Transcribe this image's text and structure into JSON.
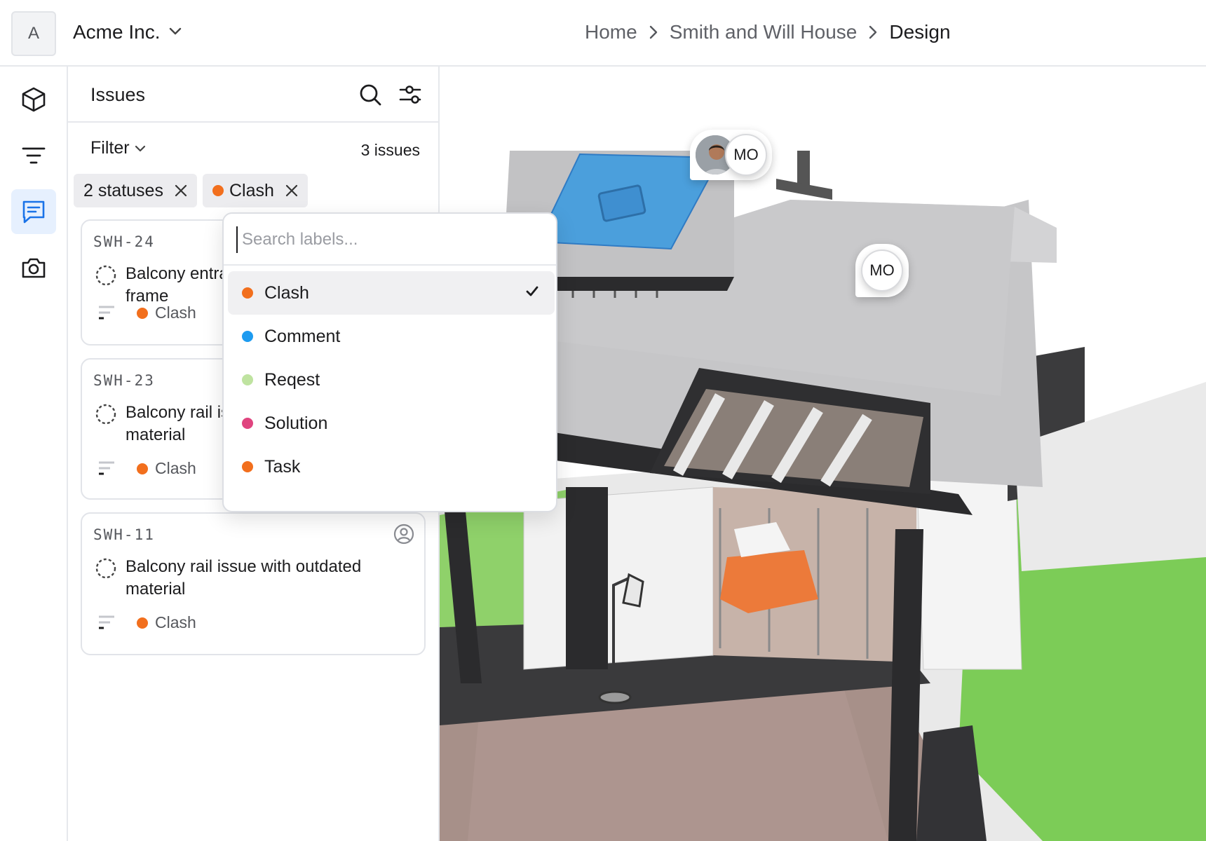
{
  "org": {
    "avatar_letter": "A",
    "name": "Acme Inc."
  },
  "breadcrumb": [
    "Home",
    "Smith and Will House",
    "Design"
  ],
  "rail": {
    "items": [
      {
        "name": "model-icon"
      },
      {
        "name": "filter-lines-icon"
      },
      {
        "name": "issues-icon",
        "active": true
      },
      {
        "name": "camera-icon"
      }
    ]
  },
  "issues_panel": {
    "title": "Issues",
    "filter_label": "Filter",
    "count_text": "3 issues",
    "chips": [
      {
        "label": "2 statuses"
      },
      {
        "label": "Clash",
        "color": "#f26f1d"
      }
    ],
    "cards": [
      {
        "id": "SWH-24",
        "title": "Balcony entrance misaligned with frame",
        "label": "Clash",
        "label_color": "#f26f1d"
      },
      {
        "id": "SWH-23",
        "title": "Balcony rail issue with outdated material",
        "label": "Clash",
        "label_color": "#f26f1d"
      },
      {
        "id": "SWH-11",
        "title": "Balcony rail issue with outdated material",
        "label": "Clash",
        "label_color": "#f26f1d"
      }
    ]
  },
  "label_dropdown": {
    "placeholder": "Search labels...",
    "options": [
      {
        "label": "Clash",
        "color": "#f26f1d",
        "checked": true
      },
      {
        "label": "Comment",
        "color": "#1d9bf0",
        "checked": false
      },
      {
        "label": "Reqest",
        "color": "#bfe3a0",
        "checked": false
      },
      {
        "label": "Solution",
        "color": "#e0447f",
        "checked": false
      },
      {
        "label": "Task",
        "color": "#f26f1d",
        "checked": false
      }
    ]
  },
  "viewport": {
    "markers": [
      {
        "initials": "MO"
      },
      {
        "initials": "MO"
      }
    ]
  }
}
